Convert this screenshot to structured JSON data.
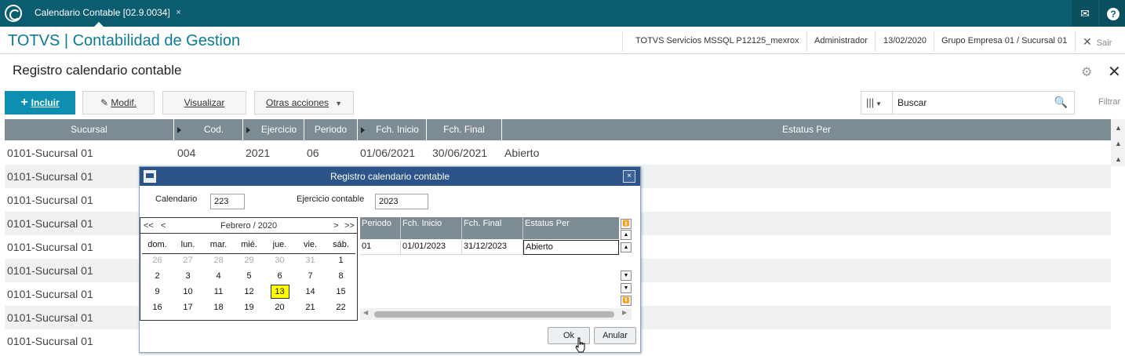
{
  "topbar": {
    "tab_label": "Calendario Contable [02.9.0034]",
    "tab_close": "×"
  },
  "header": {
    "brand": "TOTVS | Contabilidad de Gestion",
    "server": "TOTVS Servicios MSSQL P12125_mexrox",
    "user": "Administrador",
    "date": "13/02/2020",
    "company": "Grupo Empresa 01 / Sucursal 01",
    "exit_label": "Sair"
  },
  "page": {
    "title": "Registro calendario contable"
  },
  "toolbar": {
    "include": "Incluir",
    "modify": "Modif.",
    "view": "Visualizar",
    "other_actions": "Otras acciones",
    "search_placeholder": "Buscar",
    "filter": "Filtrar"
  },
  "grid": {
    "columns": [
      "Sucursal",
      "Cod. Calenda",
      "Ejercicio",
      "Periodo",
      "Fch. Inicio",
      "Fch. Final",
      "Estatus Per"
    ],
    "first_row": [
      "0101-Sucursal 01",
      "004",
      "2021",
      "06",
      "01/06/2021",
      "30/06/2021",
      "Abierto"
    ],
    "rows": [
      "0101-Sucursal 01",
      "0101-Sucursal 01",
      "0101-Sucursal 01",
      "0101-Sucursal 01",
      "0101-Sucursal 01",
      "0101-Sucursal 01",
      "0101-Sucursal 01",
      "0101-Sucursal 01",
      "0101-Sucursal 01"
    ]
  },
  "dialog": {
    "title": "Registro calendario contable",
    "calendario_label": "Calendario",
    "calendario_value": "223",
    "ejercicio_label": "Ejercicio contable",
    "ejercicio_value": "2023",
    "calendar": {
      "prev_year": "<<",
      "prev_month": "<",
      "month_year": "Febrero / 2020",
      "next_month": ">",
      "next_year": ">>",
      "weekdays": [
        "dom.",
        "lun.",
        "mar.",
        "mié.",
        "jue.",
        "vie.",
        "sáb."
      ],
      "weeks": [
        [
          "26",
          "27",
          "28",
          "29",
          "30",
          "31",
          "1"
        ],
        [
          "2",
          "3",
          "4",
          "5",
          "6",
          "7",
          "8"
        ],
        [
          "9",
          "10",
          "11",
          "12",
          "13",
          "14",
          "15"
        ],
        [
          "16",
          "17",
          "18",
          "19",
          "20",
          "21",
          "22"
        ]
      ],
      "today": "13"
    },
    "periods": {
      "columns": [
        "Periodo",
        "Fch. Inicio",
        "Fch. Final",
        "Estatus Per"
      ],
      "row": [
        "01",
        "01/01/2023",
        "31/12/2023",
        "Abierto"
      ]
    },
    "ok": "Ok",
    "cancel": "Anular",
    "close": "×"
  },
  "colors": {
    "topbar": "#0b5c6e",
    "brand": "#0b7a93",
    "primary_button": "#0c8fb0",
    "grid_header": "#7d8c92",
    "dialog_title": "#2c5489",
    "today_highlight": "#ffff00"
  }
}
